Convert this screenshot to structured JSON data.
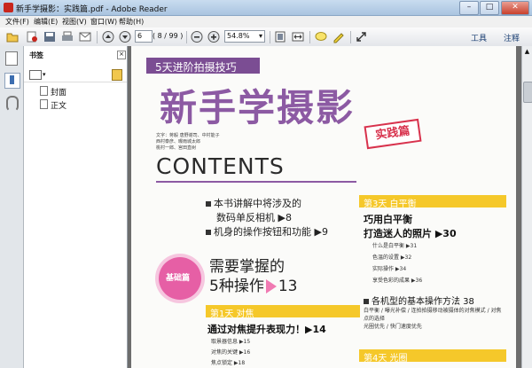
{
  "window": {
    "title": "新手学摄影：实践篇.pdf - Adobe Reader"
  },
  "menu": [
    "文件(F)",
    "编辑(E)",
    "视图(V)",
    "窗口(W)",
    "帮助(H)"
  ],
  "toolbar": {
    "page_current": "6",
    "page_count": "( 8 / 99 )",
    "zoom": "54.8%",
    "tools_label": "工具",
    "comment_label": "注释"
  },
  "bookmarks": {
    "title": "书签",
    "close": "×",
    "items": [
      {
        "label": "封面"
      },
      {
        "label": "正文"
      }
    ]
  },
  "page": {
    "banner": "5天进阶拍摄技巧",
    "title": "新手学摄影",
    "stamp": "实践篇",
    "credits": "文字：蒋毅 唐野谢司、中村能子\n西村泰彦、曝雨城太郎\n桃村一郎、宫田直树",
    "contents": "CONTENTS",
    "intro_lines": [
      "本书讲解中将涉及的",
      "数码单反相机 ▶8",
      "机身的操作按钮和功能 ▶9"
    ],
    "circle_label": "基础篇",
    "topic1_line1": "需要掌握的",
    "topic1_line2": "5种操作",
    "topic1_page": "13",
    "day1_label": "第1天 对焦",
    "day1_title": "通过对焦提升表现力！▶14",
    "day1_items": [
      "取景器信息 ▶15",
      "对焦的关键 ▶16",
      "焦点锁定 ▶18"
    ],
    "day3_label": "第3天 白平衡",
    "day3_title1": "巧用白平衡",
    "day3_title2": "打造迷人的照片 ▶30",
    "day3_items": [
      "什么是白平衡 ▶31",
      "色温的设置 ▶32",
      "实际操作 ▶34",
      "享受色彩的成果 ▶36"
    ],
    "section2": "各机型的基本操作方法 38",
    "section2_desc": "白平衡 / 曝光补偿 / 连拍拍摄移动被摄体的对焦模式 / 对焦点的选择\n光圈优先 / 快门速度优先",
    "day4_label": "第4天 光圈"
  },
  "colors": {
    "accent_purple": "#8c5aa3",
    "accent_yellow": "#f5c82a",
    "accent_pink": "#e65fa5",
    "stamp_red": "#d8324d"
  }
}
